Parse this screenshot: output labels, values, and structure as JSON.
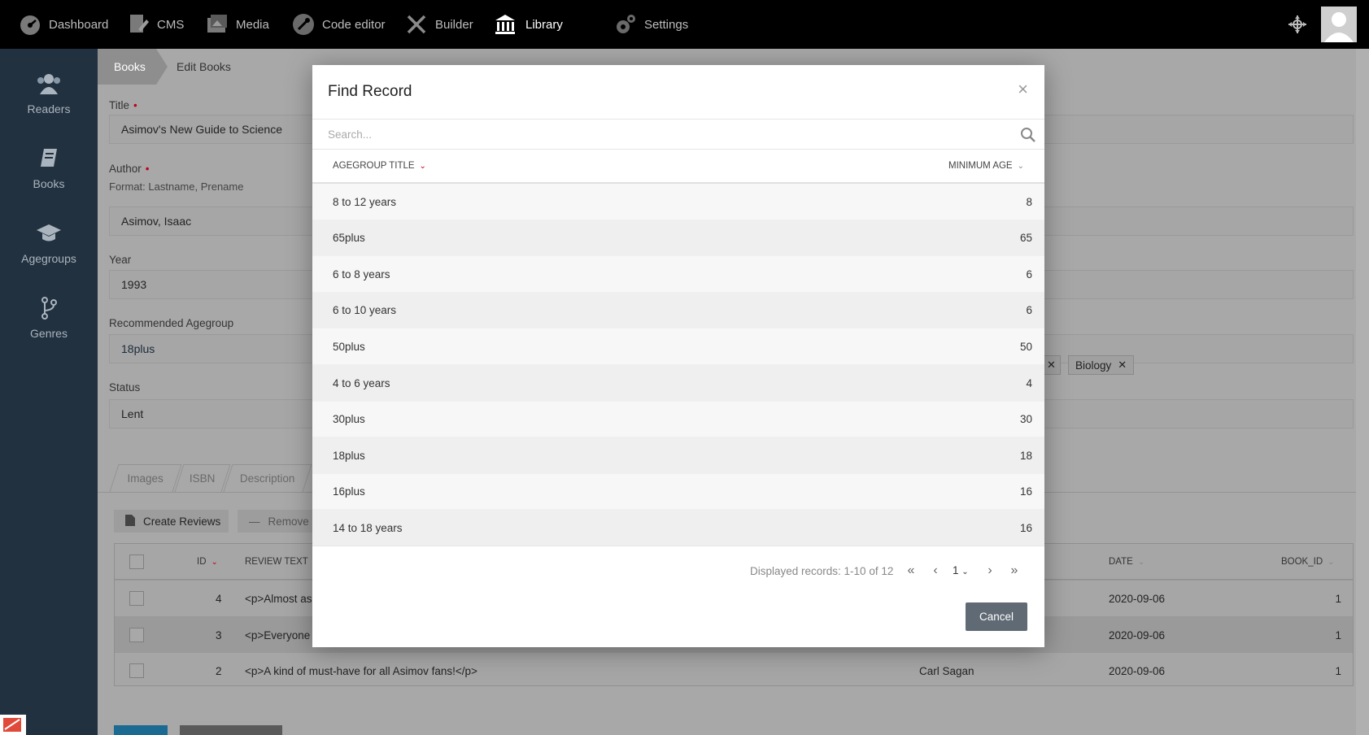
{
  "topnav": {
    "items": [
      {
        "label": "Dashboard",
        "icon": "dashboard-icon"
      },
      {
        "label": "CMS",
        "icon": "cms-icon"
      },
      {
        "label": "Media",
        "icon": "media-icon"
      },
      {
        "label": "Code editor",
        "icon": "wrench-icon"
      },
      {
        "label": "Builder",
        "icon": "tools-icon"
      },
      {
        "label": "Library",
        "icon": "library-icon"
      },
      {
        "label": "Settings",
        "icon": "gears-icon"
      }
    ],
    "active": "Library"
  },
  "sidebar": {
    "items": [
      {
        "label": "Readers",
        "icon": "users-icon"
      },
      {
        "label": "Books",
        "icon": "book-icon"
      },
      {
        "label": "Agegroups",
        "icon": "graduation-cap-icon"
      },
      {
        "label": "Genres",
        "icon": "branch-icon"
      }
    ]
  },
  "breadcrumb": {
    "parent": "Books",
    "current": "Edit Books"
  },
  "form": {
    "title_label": "Title",
    "title_value": "Asimov's New Guide to Science",
    "author_label": "Author",
    "author_hint": "Format: Lastname, Prename",
    "author_value": "Asimov, Isaac",
    "year_label": "Year",
    "year_value": "1993",
    "agegroup_label": "Recommended Agegroup",
    "agegroup_value": "18plus",
    "status_label": "Status",
    "status_value": "Lent",
    "genre_tags": [
      "Biology"
    ],
    "tabs": [
      "Images",
      "ISBN",
      "Description"
    ],
    "create_reviews_label": "Create Reviews",
    "remove_label": "Remove"
  },
  "reviews_grid": {
    "headers": {
      "id": "ID",
      "review_text": "REVIEW TEXT",
      "date": "DATE",
      "book_id": "BOOK_ID"
    },
    "rows": [
      {
        "id": "4",
        "text": "<p>Almost as",
        "author": "",
        "date": "2020-09-06",
        "book_id": "1"
      },
      {
        "id": "3",
        "text": "<p>Everyone",
        "author": "",
        "date": "2020-09-06",
        "book_id": "1"
      },
      {
        "id": "2",
        "text": "<p>A kind of must-have for all Asimov fans!</p>",
        "author": "Carl Sagan",
        "date": "2020-09-06",
        "book_id": "1"
      }
    ]
  },
  "modal": {
    "title": "Find Record",
    "close": "×",
    "search_placeholder": "Search...",
    "col_title": "AGEGROUP TITLE",
    "col_min_age": "MINIMUM AGE",
    "rows": [
      {
        "title": "8 to 12 years",
        "min_age": "8"
      },
      {
        "title": "65plus",
        "min_age": "65"
      },
      {
        "title": "6 to 8 years",
        "min_age": "6"
      },
      {
        "title": "6 to 10 years",
        "min_age": "6"
      },
      {
        "title": "50plus",
        "min_age": "50"
      },
      {
        "title": "4 to 6 years",
        "min_age": "4"
      },
      {
        "title": "30plus",
        "min_age": "30"
      },
      {
        "title": "18plus",
        "min_age": "18"
      },
      {
        "title": "16plus",
        "min_age": "16"
      },
      {
        "title": "14 to 18 years",
        "min_age": "16"
      }
    ],
    "pager_text": "Displayed records: 1-10 of 12",
    "page": "1",
    "cancel_label": "Cancel"
  },
  "colors": {
    "topbar": "#000000",
    "sidebar": "#22313f",
    "accent_red": "#c0001a",
    "cancel_button": "#5f6a74"
  }
}
